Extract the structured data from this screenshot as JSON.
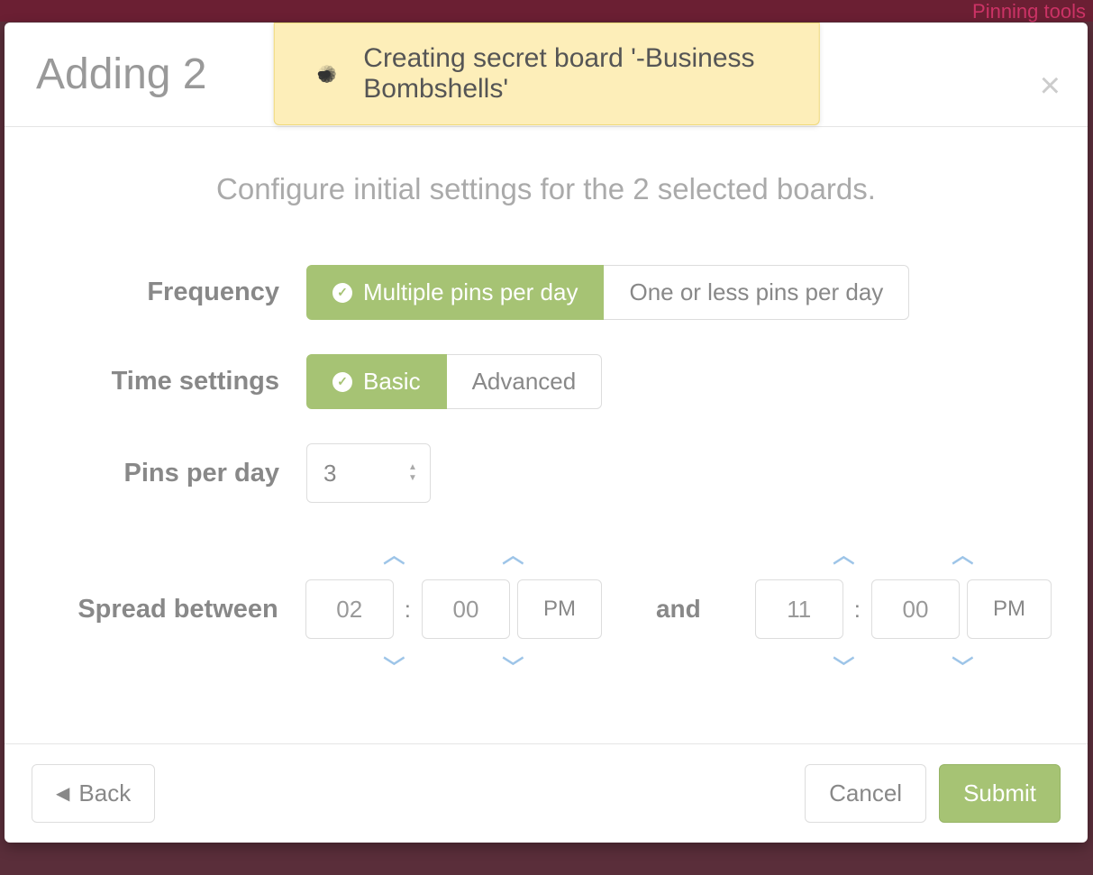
{
  "top_bar": {
    "link_text": "Pinning tools"
  },
  "modal": {
    "title": "Adding 2",
    "close": "×"
  },
  "toast": {
    "message": "Creating secret board '-Business Bombshells'"
  },
  "subheading": "Configure initial settings for the 2 selected boards.",
  "form": {
    "frequency": {
      "label": "Frequency",
      "option_multiple": "Multiple pins per day",
      "option_single": "One or less pins per day",
      "selected": "multiple"
    },
    "time_settings": {
      "label": "Time settings",
      "option_basic": "Basic",
      "option_advanced": "Advanced",
      "selected": "basic"
    },
    "pins_per_day": {
      "label": "Pins per day",
      "value": "3"
    },
    "spread": {
      "label": "Spread between",
      "and_label": "and",
      "start": {
        "hour": "02",
        "minute": "00",
        "ampm": "PM"
      },
      "end": {
        "hour": "11",
        "minute": "00",
        "ampm": "PM"
      }
    }
  },
  "footer": {
    "back": "Back",
    "cancel": "Cancel",
    "submit": "Submit"
  }
}
